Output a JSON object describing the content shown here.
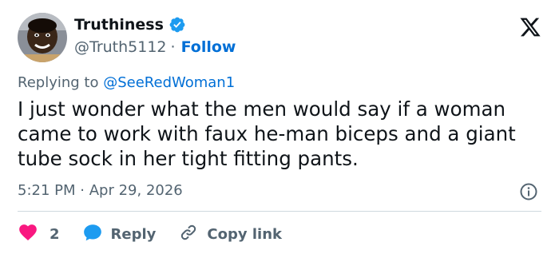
{
  "user": {
    "name": "Truthiness",
    "handle": "@Truth5112",
    "separator": "·",
    "follow_label": "Follow"
  },
  "reply_context": {
    "prefix": "Replying to",
    "mention": "@SeeRedWoman1"
  },
  "tweet": {
    "text": "I just wonder what the men would say if a woman came to work with faux he-man biceps and a giant tube sock in her tight fitting pants.",
    "time": "5:21 PM",
    "date_separator": "·",
    "date": "Apr 29, 2026"
  },
  "actions": {
    "like_count": "2",
    "reply_label": "Reply",
    "copy_label": "Copy link"
  },
  "colors": {
    "link": "#006fd6",
    "muted": "#536471",
    "like": "#f91880",
    "verified": "#1d9bf0"
  },
  "icons": {
    "logo": "x-logo-icon",
    "verified": "verified-badge-icon",
    "info": "info-icon",
    "heart": "heart-icon",
    "reply": "speech-bubble-icon",
    "copy": "link-icon"
  }
}
